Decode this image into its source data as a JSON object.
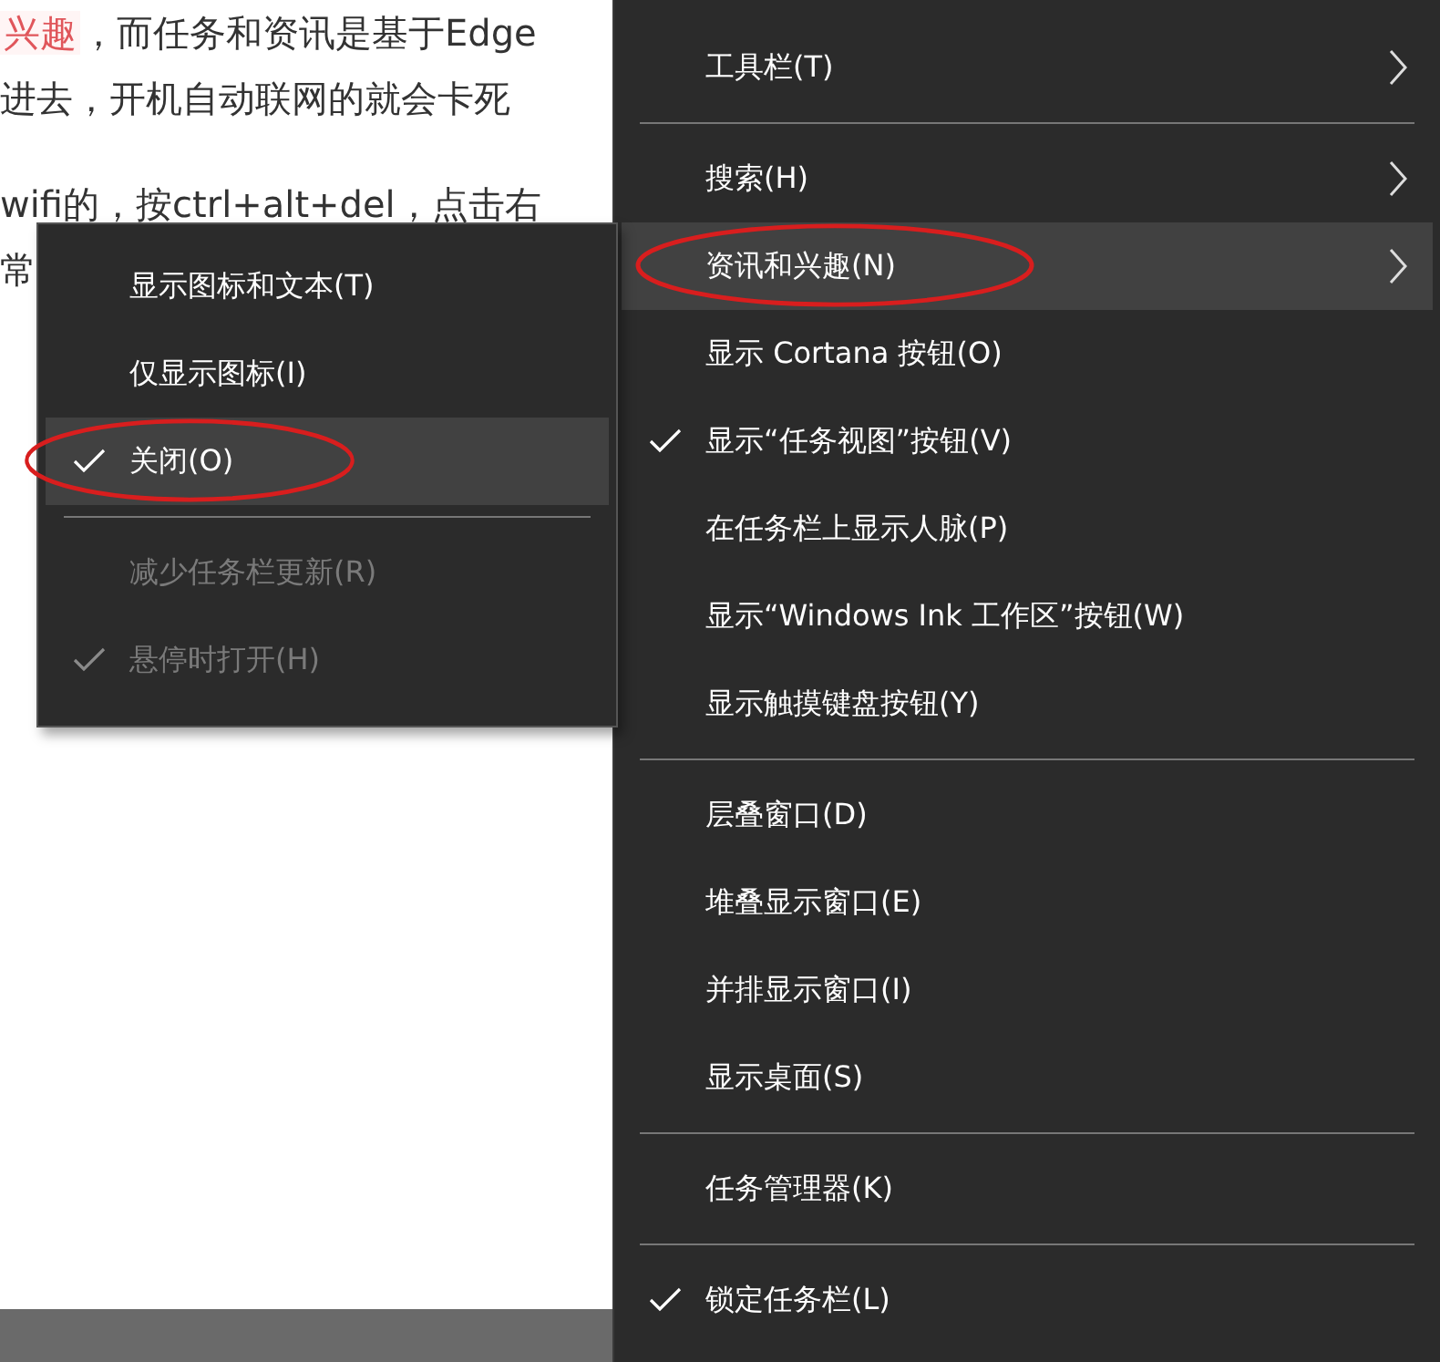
{
  "article": {
    "lines": [
      {
        "highlight": "兴趣",
        "text": "，而任务和资讯是基于Edge"
      },
      {
        "text": "进去，开机自动联网的就会卡死"
      },
      {
        "text": "wifi的，按ctrl+alt+del，点击右"
      },
      {
        "text": "常"
      }
    ]
  },
  "context_menu": {
    "items": [
      {
        "kind": "item",
        "label": "工具栏(T)",
        "submenu": true,
        "selected": false,
        "checked": false,
        "disabled": false,
        "circled": false
      },
      {
        "kind": "divider"
      },
      {
        "kind": "item",
        "label": "搜索(H)",
        "submenu": true,
        "selected": false,
        "checked": false,
        "disabled": false,
        "circled": false
      },
      {
        "kind": "item",
        "label": "资讯和兴趣(N)",
        "submenu": true,
        "selected": true,
        "checked": false,
        "disabled": false,
        "circled": true
      },
      {
        "kind": "item",
        "label": "显示 Cortana 按钮(O)",
        "submenu": false,
        "selected": false,
        "checked": false,
        "disabled": false,
        "circled": false
      },
      {
        "kind": "item",
        "label": "显示“任务视图”按钮(V)",
        "submenu": false,
        "selected": false,
        "checked": true,
        "disabled": false,
        "circled": false
      },
      {
        "kind": "item",
        "label": "在任务栏上显示人脉(P)",
        "submenu": false,
        "selected": false,
        "checked": false,
        "disabled": false,
        "circled": false
      },
      {
        "kind": "item",
        "label": "显示“Windows Ink 工作区”按钮(W)",
        "submenu": false,
        "selected": false,
        "checked": false,
        "disabled": false,
        "circled": false
      },
      {
        "kind": "item",
        "label": "显示触摸键盘按钮(Y)",
        "submenu": false,
        "selected": false,
        "checked": false,
        "disabled": false,
        "circled": false
      },
      {
        "kind": "divider"
      },
      {
        "kind": "item",
        "label": "层叠窗口(D)",
        "submenu": false,
        "selected": false,
        "checked": false,
        "disabled": false,
        "circled": false
      },
      {
        "kind": "item",
        "label": "堆叠显示窗口(E)",
        "submenu": false,
        "selected": false,
        "checked": false,
        "disabled": false,
        "circled": false
      },
      {
        "kind": "item",
        "label": "并排显示窗口(I)",
        "submenu": false,
        "selected": false,
        "checked": false,
        "disabled": false,
        "circled": false
      },
      {
        "kind": "item",
        "label": "显示桌面(S)",
        "submenu": false,
        "selected": false,
        "checked": false,
        "disabled": false,
        "circled": false
      },
      {
        "kind": "divider"
      },
      {
        "kind": "item",
        "label": "任务管理器(K)",
        "submenu": false,
        "selected": false,
        "checked": false,
        "disabled": false,
        "circled": false
      },
      {
        "kind": "divider"
      },
      {
        "kind": "item",
        "label": "锁定任务栏(L)",
        "submenu": false,
        "selected": false,
        "checked": true,
        "disabled": false,
        "circled": false
      }
    ]
  },
  "submenu": {
    "items": [
      {
        "kind": "item",
        "label": "显示图标和文本(T)",
        "selected": false,
        "checked": false,
        "disabled": false,
        "circled": false
      },
      {
        "kind": "item",
        "label": "仅显示图标(I)",
        "selected": false,
        "checked": false,
        "disabled": false,
        "circled": false
      },
      {
        "kind": "item",
        "label": "关闭(O)",
        "selected": true,
        "checked": true,
        "disabled": false,
        "circled": true
      },
      {
        "kind": "divider"
      },
      {
        "kind": "item",
        "label": "减少任务栏更新(R)",
        "selected": false,
        "checked": false,
        "disabled": true,
        "circled": false
      },
      {
        "kind": "item",
        "label": "悬停时打开(H)",
        "selected": false,
        "checked": true,
        "disabled": true,
        "circled": false
      }
    ]
  }
}
